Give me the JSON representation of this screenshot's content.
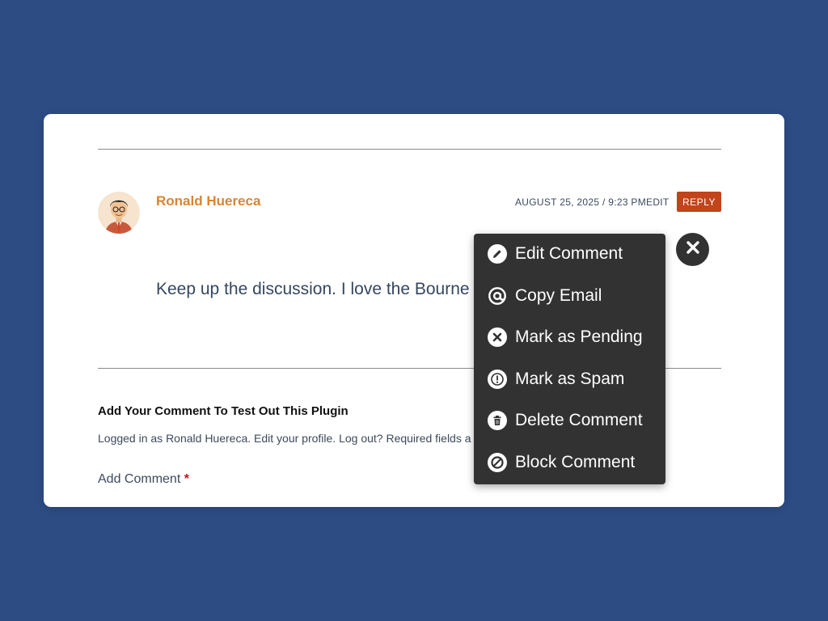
{
  "comment": {
    "author": "Ronald Huereca",
    "meta": "AUGUST 25, 2025 / 9:23 PMEDIT",
    "reply_label": "REPLY",
    "text": "Keep up the discussion. I love the Bourne"
  },
  "form": {
    "title": "Add Your Comment To Test Out This Plugin",
    "logged_in": "Logged in as Ronald Huereca. Edit your profile. Log out? Required fields a",
    "add_label": "Add Comment",
    "required_mark": "*"
  },
  "menu": {
    "items": [
      {
        "label": "Edit Comment",
        "icon": "pencil-icon"
      },
      {
        "label": "Copy Email",
        "icon": "at-sign-icon"
      },
      {
        "label": "Mark as Pending",
        "icon": "x-circle-icon"
      },
      {
        "label": "Mark as Spam",
        "icon": "exclamation-icon"
      },
      {
        "label": "Delete Comment",
        "icon": "trash-icon"
      },
      {
        "label": "Block Comment",
        "icon": "block-icon"
      }
    ]
  },
  "colors": {
    "background": "#2d4c84",
    "author": "#d98533",
    "reply": "#c2441a",
    "menu": "#323232"
  }
}
